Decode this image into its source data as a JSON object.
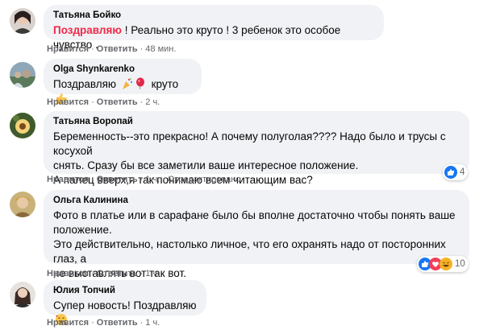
{
  "reactions_colors": {
    "like": "#1877f2",
    "love": "#f33e58",
    "haha": "#f7b125"
  },
  "comments": [
    {
      "author": "Татьяна Бойко",
      "highlight": "Поздравляю",
      "text": "! Реально это круто ! 3 ребенок это особое чувство .",
      "like": "Нравится",
      "reply": "Ответить",
      "time": "48 мин."
    },
    {
      "author": "Olga Shynkarenko",
      "text_before": "Поздравляю",
      "text_after": "круто",
      "like": "Нравится",
      "reply": "Ответить",
      "time": "2 ч."
    },
    {
      "author": "Татьяна Воропай",
      "lines": [
        "Беременность--это прекрасно! А почему полуголая???? Надо было и трусы с косухой",
        "снять. Сразу бы все заметили ваше интересное положение.",
        "А палец вверх,я так понимаю всем читающим вас?"
      ],
      "like": "Нравится",
      "reply": "Ответить",
      "time": "1 ч.",
      "edited": "Отредактировано",
      "reaction_count": "4"
    },
    {
      "author": "Ольга Калинина",
      "lines": [
        "Фото в платье или в сарафане было бы вполне достаточно чтобы понять ваше",
        "положение.",
        "Это действительно, настолько личное, что его охранять надо от посторонних глаз, а",
        "не выставлять вот так вот."
      ],
      "like": "Нравится",
      "reply": "Ответить",
      "time": "1 ч.",
      "reaction_count": "10"
    },
    {
      "author": "Юлия Топчий",
      "text": "Супер новость! Поздравляю",
      "like": "Нравится",
      "reply": "Ответить",
      "time": "1 ч."
    }
  ]
}
